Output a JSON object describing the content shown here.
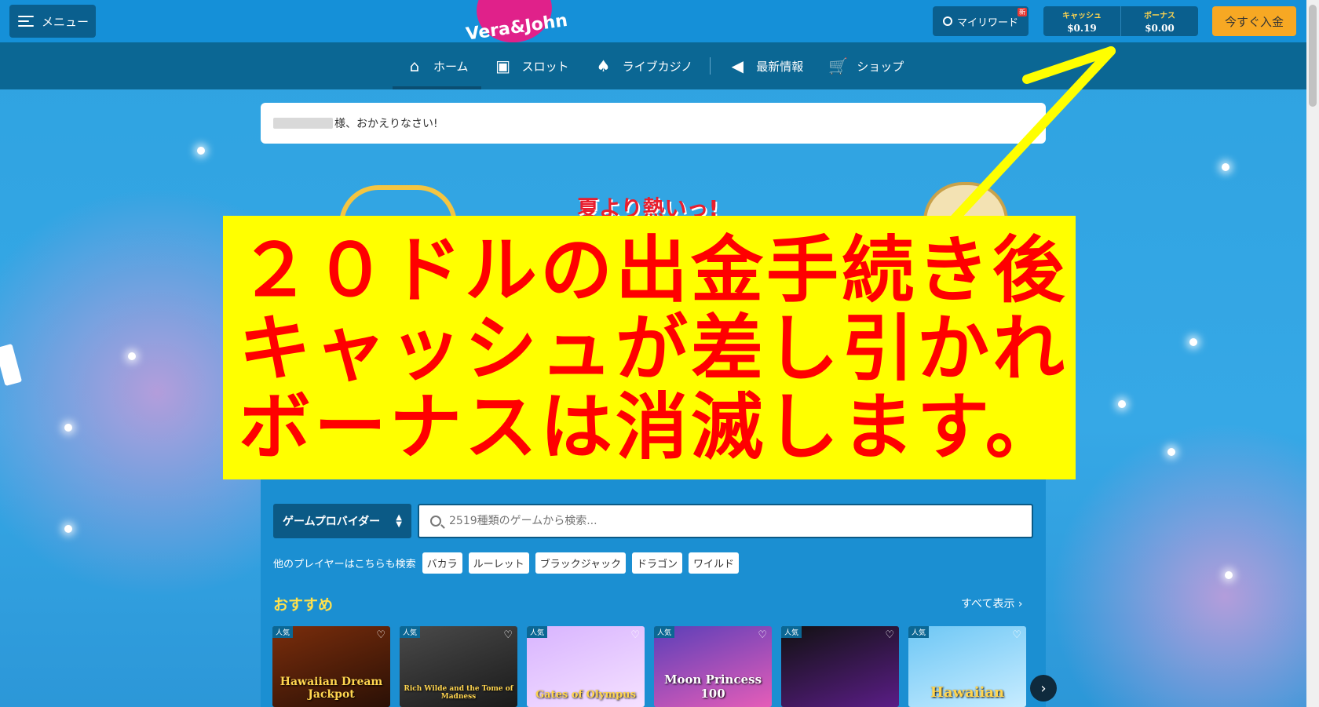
{
  "header": {
    "menu_label": "メニュー",
    "logo_text": "Vera&John",
    "rewards_label": "マイリワード",
    "rewards_badge": "新",
    "cash_label": "キャッシュ",
    "cash_value": "$0.19",
    "bonus_label": "ボーナス",
    "bonus_value": "$0.00",
    "deposit_label": "今すぐ入金"
  },
  "nav": {
    "items": [
      {
        "label": "ホーム",
        "icon": "home-icon"
      },
      {
        "label": "スロット",
        "icon": "slot-icon"
      },
      {
        "label": "ライブカジノ",
        "icon": "cards-icon"
      },
      {
        "label": "最新情報",
        "icon": "megaphone-icon"
      },
      {
        "label": "ショップ",
        "icon": "cart-icon"
      }
    ]
  },
  "welcome": {
    "text": "様、おかえりなさい!"
  },
  "banner": {
    "title": "夏より熱いっ!"
  },
  "annotation": {
    "line1": "２０ドルの出金手続き後",
    "line2": "キャッシュが差し引かれ",
    "line3": "ボーナスは消滅します。",
    "arrow_color": "#ffff00"
  },
  "lobby": {
    "provider_label": "ゲームプロバイダー",
    "search_placeholder": "2519種類のゲームから検索...",
    "tags_intro": "他のプレイヤーはこちらも検索",
    "tags": [
      "バカラ",
      "ルーレット",
      "ブラックジャック",
      "ドラゴン",
      "ワイルド"
    ],
    "section_title": "おすすめ",
    "show_all": "すべて表示 ›",
    "games": [
      {
        "badge": "人気",
        "name": "Hawaiian Dream Jackpot"
      },
      {
        "badge": "人気",
        "name": "Rich Wilde and the Tome of Madness"
      },
      {
        "badge": "人気",
        "name": "Gates of Olympus"
      },
      {
        "badge": "人気",
        "name": "Moon Princess 100"
      },
      {
        "badge": "人気",
        "name": ""
      },
      {
        "badge": "人気",
        "name": "Hawaiian"
      }
    ]
  },
  "colors": {
    "background": "#2ea2e0",
    "topbar": "#1590d8",
    "navbar": "#0b6794",
    "deposit": "#f7a823",
    "overlay_bg": "#ffff00",
    "overlay_text": "#ff0000"
  }
}
